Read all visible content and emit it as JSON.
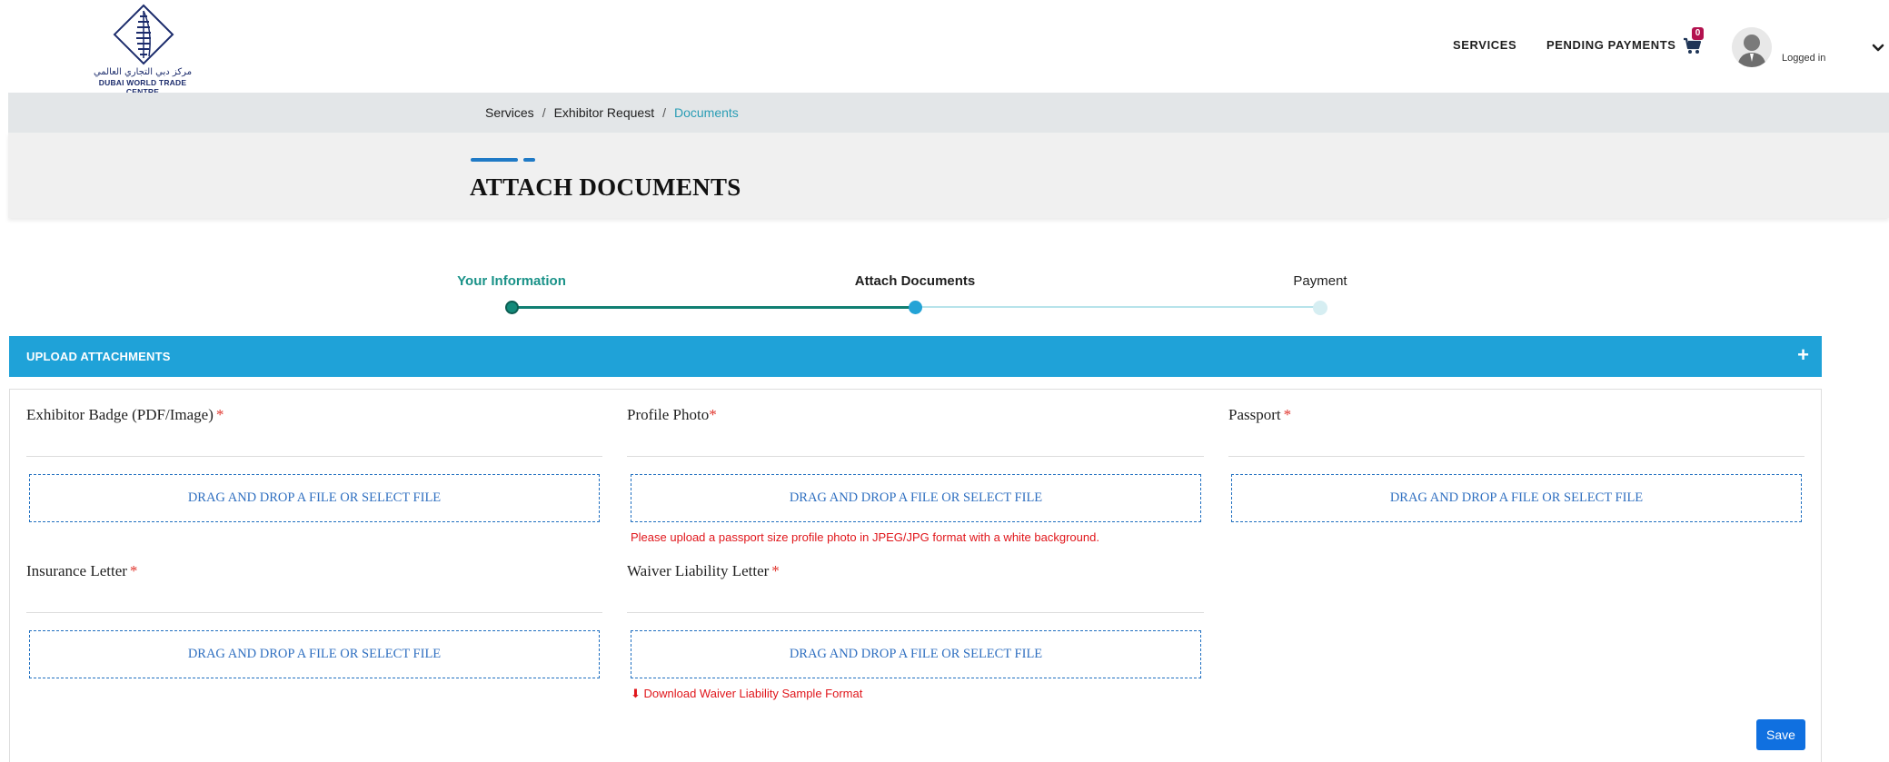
{
  "header": {
    "logo_arabic": "مركز دبي التجاري العالمي",
    "logo_english": "DUBAI WORLD TRADE CENTRE",
    "nav_services": "SERVICES",
    "nav_pending": "PENDING PAYMENTS",
    "cart_count": "0",
    "user_status": "Logged in"
  },
  "breadcrumb": {
    "items": [
      "Services",
      "Exhibitor Request",
      "Documents"
    ],
    "separator": "/"
  },
  "page": {
    "title": "ATTACH DOCUMENTS"
  },
  "stepper": {
    "steps": [
      {
        "label": "Your Information",
        "state": "done"
      },
      {
        "label": "Attach Documents",
        "state": "current"
      },
      {
        "label": "Payment",
        "state": "upcoming"
      }
    ]
  },
  "panel": {
    "title": "UPLOAD ATTACHMENTS",
    "toggle": "+",
    "fields": [
      {
        "label": "Exhibitor Badge (PDF/Image)",
        "required": "*",
        "dropzone": "DRAG AND DROP A FILE OR SELECT FILE"
      },
      {
        "label": "Profile Photo",
        "required": "*",
        "dropzone": "DRAG AND DROP A FILE OR SELECT FILE",
        "hint": "Please upload a passport size profile photo in JPEG/JPG format with a white background."
      },
      {
        "label": "Passport",
        "required": "*",
        "dropzone": "DRAG AND DROP A FILE OR SELECT FILE"
      },
      {
        "label": "Insurance Letter",
        "required": "*",
        "dropzone": "DRAG AND DROP A FILE OR SELECT FILE"
      },
      {
        "label": "Waiver Liability Letter",
        "required": "*",
        "dropzone": "DRAG AND DROP A FILE OR SELECT FILE",
        "hint": "⬇ Download Waiver Liability Sample Format"
      }
    ],
    "save_label": "Save"
  },
  "colors": {
    "primary_blue": "#1fa2d8",
    "step_done": "#138a7a",
    "required_red": "#e0342c",
    "hint_red": "#e0161b",
    "button_blue": "#1070e0"
  }
}
